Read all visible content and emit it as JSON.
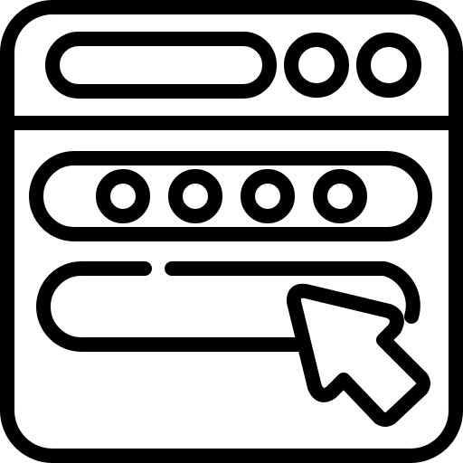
{
  "icon": {
    "name": "login-form-with-cursor-icon",
    "stroke_color": "#000000",
    "fill_color": "#ffffff"
  },
  "window": {
    "address_bar_icon": "address-bar-icon",
    "control_icons": [
      "window-control-circle-icon",
      "window-control-circle-icon"
    ]
  },
  "form": {
    "password_field_icon": "password-field-icon",
    "password_dot_count": 4,
    "input_field_icon": "input-field-icon",
    "cursor_icon": "mouse-pointer-icon"
  }
}
